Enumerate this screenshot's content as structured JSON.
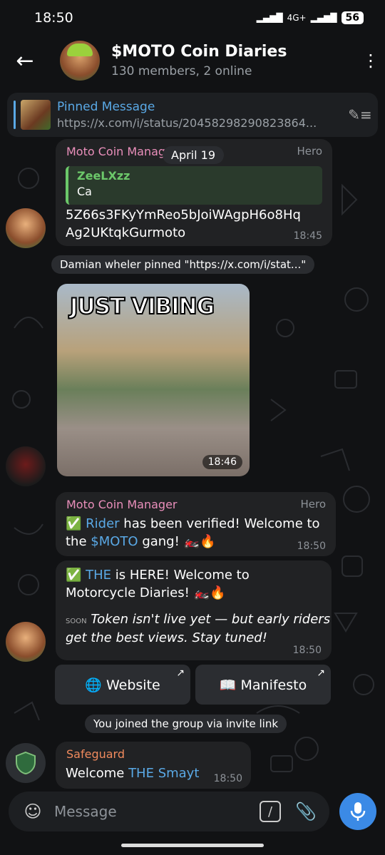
{
  "status": {
    "time": "18:50",
    "network": "4G+",
    "battery": "56"
  },
  "header": {
    "title": "$MOTO Coin Diaries",
    "subtitle": "130 members, 2 online"
  },
  "pinned": {
    "title": "Pinned Message",
    "url": "https://x.com/i/status/20458298290823864..."
  },
  "date_chip": "April 19",
  "msg1": {
    "sender": "Moto Coin Manager",
    "role": "Hero",
    "quote_name": "ZeeLXzz",
    "quote_text": "Ca",
    "text_line1": "5Z66s3FKyYmReo5bJoiWAgpH6o8Hq",
    "text_line2": "Ag2UKtqkGurmoto",
    "time": "18:45"
  },
  "system_pin": "Damian wheler pinned \"https://x.com/i/stat...\"",
  "photo": {
    "caption": "JUST VIBING",
    "time": "18:46"
  },
  "msg2": {
    "sender": "Moto Coin Manager",
    "role": "Hero",
    "check": "✅",
    "line1_link": "Rider",
    "line1_rest": " has been verified! Welcome to",
    "line2_pre": "the ",
    "line2_link": "$MOTO",
    "line2_rest": " gang! 🏍️🔥",
    "time": "18:50"
  },
  "msg3": {
    "check": "✅",
    "line1_link": "THE",
    "line1_rest": " is HERE! Welcome to",
    "line2": "Motorcycle Diaries! 🏍️🔥",
    "soon_line1": "Token isn't live yet — but early riders",
    "soon_line2": "get the best views. Stay tuned!",
    "soon_label": "SOON",
    "time": "18:50"
  },
  "buttons": {
    "website": "🌐 Website",
    "manifesto": "📖 Manifesto"
  },
  "system_join": "You joined the group via invite link",
  "msg4": {
    "sender": "Safeguard",
    "pre": "Welcome ",
    "link": "THE Smayt",
    "time": "18:50"
  },
  "composer": {
    "placeholder": "Message"
  },
  "colors": {
    "accent": "#5aa9e6",
    "sender_pink": "#ea8fbb",
    "sender_orange": "#f08a5d",
    "mic_blue": "#3b8ae6"
  }
}
